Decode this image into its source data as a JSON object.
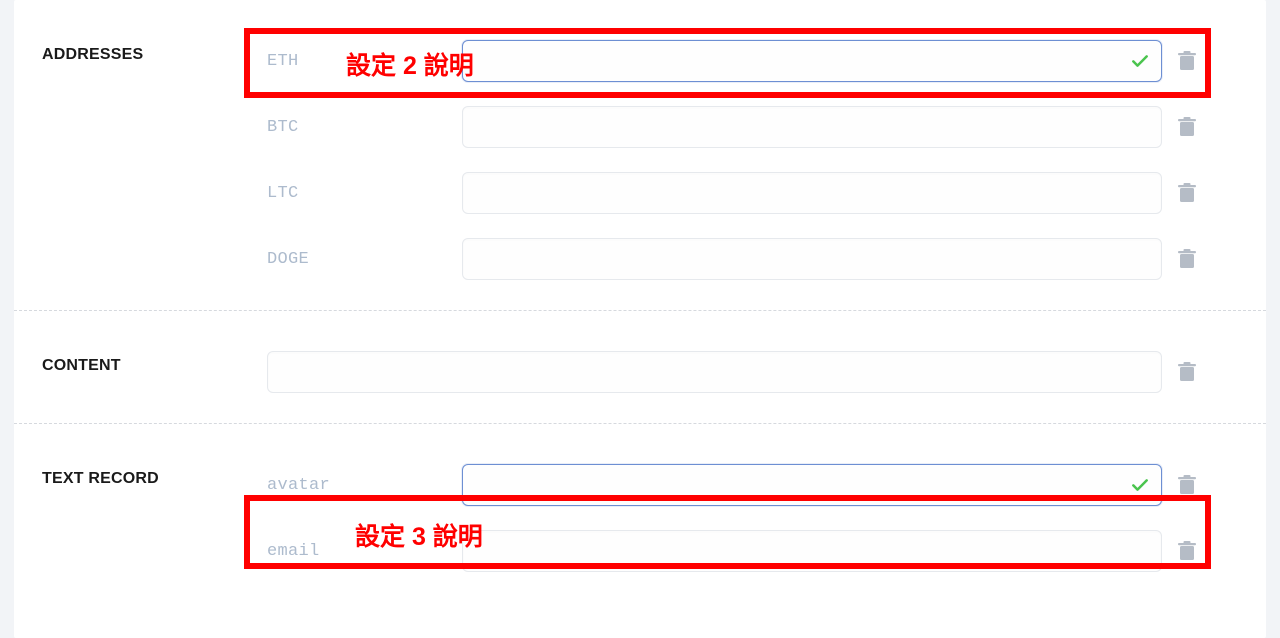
{
  "sections": {
    "addresses": {
      "title": "ADDRESSES",
      "fields": [
        {
          "label": "ETH",
          "value": "",
          "highlighted": true,
          "valid": true
        },
        {
          "label": "BTC",
          "value": ""
        },
        {
          "label": "LTC",
          "value": ""
        },
        {
          "label": "DOGE",
          "value": ""
        }
      ]
    },
    "content": {
      "title": "CONTENT",
      "fields": [
        {
          "label": "",
          "value": ""
        }
      ]
    },
    "text_record": {
      "title": "TEXT RECORD",
      "fields": [
        {
          "label": "avatar",
          "value": "",
          "highlighted": true,
          "valid": true
        },
        {
          "label": "email",
          "value": ""
        }
      ]
    }
  },
  "annotations": {
    "highlight_1": "設定 2 說明",
    "highlight_2": "設定 3 說明"
  },
  "colors": {
    "highlight_border": "#ff0000",
    "check_green": "#4ac44e",
    "trash_gray": "#b5bcc6",
    "label_gray": "#adbbcd"
  }
}
